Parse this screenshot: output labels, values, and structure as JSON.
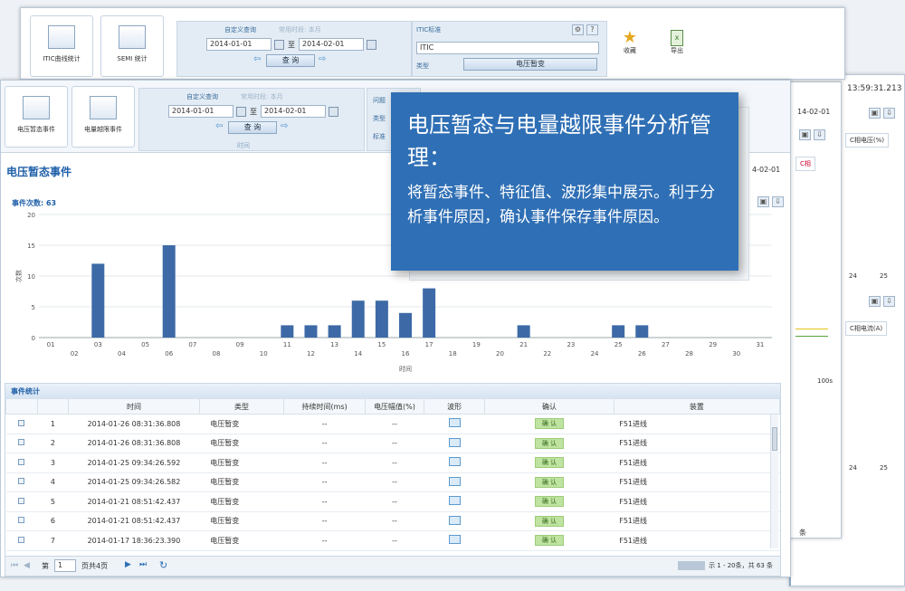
{
  "back_window": {
    "btn_itic": "ITIC曲线统计",
    "btn_semi": "SEMI 统计",
    "query_mode": "自定义查询",
    "query_mode2": "常用时段: 本月",
    "date_from": "2014-01-01",
    "to": "至",
    "date_to": "2014-02-01",
    "query_btn": "查 询",
    "itic_label": "ITIC标准",
    "itic_value": "ITIC",
    "type_label": "类型",
    "type_value": "电压暂变",
    "collect_label": "收藏",
    "export_label": "导出"
  },
  "right_window": {
    "time": "13:59:31.213",
    "date": "14-02-01",
    "legend1": "C相电压(%)",
    "legend2": "C相",
    "legend3": "C相电流(A)",
    "tick_a1": "24",
    "tick_a2": "25",
    "tick_b1": "24",
    "tick_b2": "25",
    "label_100s": "100s",
    "bottom_label": "条"
  },
  "front_window": {
    "btn_sag": "电压暂态事件",
    "btn_overlimit": "电量越限事件",
    "query_mode": "自定义查询",
    "query_mode2": "常用时段: 本月",
    "date_from": "2014-01-01",
    "to": "至",
    "date_to": "2014-02-01",
    "query_btn": "查 询",
    "group_label": "时间",
    "extra1": "问题",
    "extra2": "类型",
    "extra3": "标准",
    "title": "电压暂态事件",
    "date_right": "4-02-01",
    "event_count": "事件次数: 63",
    "stats_title": "事件统计",
    "columns": [
      "时间",
      "类型",
      "持续时间(ms)",
      "电压幅值(%)",
      "波形",
      "确认",
      "装置"
    ],
    "rows": [
      {
        "no": "1",
        "time": "2014-01-26 08:31:36.808",
        "type": "电压暂变",
        "dur": "--",
        "amp": "--",
        "confirm": "确 认",
        "device": "F51进线"
      },
      {
        "no": "2",
        "time": "2014-01-26 08:31:36.808",
        "type": "电压暂变",
        "dur": "--",
        "amp": "--",
        "confirm": "确 认",
        "device": "F51进线"
      },
      {
        "no": "3",
        "time": "2014-01-25 09:34:26.592",
        "type": "电压暂变",
        "dur": "--",
        "amp": "--",
        "confirm": "确 认",
        "device": "F51进线"
      },
      {
        "no": "4",
        "time": "2014-01-25 09:34:26.582",
        "type": "电压暂变",
        "dur": "--",
        "amp": "--",
        "confirm": "确 认",
        "device": "F51进线"
      },
      {
        "no": "5",
        "time": "2014-01-21 08:51:42.437",
        "type": "电压暂变",
        "dur": "--",
        "amp": "--",
        "confirm": "确 认",
        "device": "F51进线"
      },
      {
        "no": "6",
        "time": "2014-01-21 08:51:42.437",
        "type": "电压暂变",
        "dur": "--",
        "amp": "--",
        "confirm": "确 认",
        "device": "F51进线"
      },
      {
        "no": "7",
        "time": "2014-01-17 18:36:23.390",
        "type": "电压暂变",
        "dur": "--",
        "amp": "--",
        "confirm": "确 认",
        "device": "F51进线"
      }
    ],
    "pager": {
      "page_label": "第",
      "page_value": "1",
      "page_total": "页共4页",
      "summary": "示 1 - 20条，共 63 条"
    }
  },
  "callout": {
    "title": "电压暂态与电量越限事件分析管理：",
    "body": "将暂态事件、特征值、波形集中展示。利于分析事件原因，确认事件保存事件原因。"
  },
  "colors": {
    "bar": "#3d6aa6",
    "accent": "#2f6fb5",
    "title": "#1f5fa8"
  },
  "chart_data": {
    "type": "bar",
    "categories": [
      "01",
      "02",
      "03",
      "04",
      "05",
      "06",
      "07",
      "08",
      "09",
      "10",
      "11",
      "12",
      "13",
      "14",
      "15",
      "16",
      "17",
      "18",
      "19",
      "20",
      "21",
      "22",
      "23",
      "24",
      "25",
      "26",
      "27",
      "28",
      "29",
      "30",
      "31"
    ],
    "values": [
      0,
      0,
      12,
      0,
      0,
      15,
      0,
      0,
      0,
      0,
      2,
      2,
      2,
      6,
      6,
      4,
      8,
      0,
      0,
      0,
      2,
      0,
      0,
      0,
      2,
      2,
      0,
      0,
      0,
      0,
      0
    ],
    "xlabel": "时间",
    "ylabel": "次数",
    "ylim": [
      0,
      20
    ],
    "yticks": [
      "0",
      "5",
      "10",
      "15",
      "20"
    ],
    "grid": true
  }
}
